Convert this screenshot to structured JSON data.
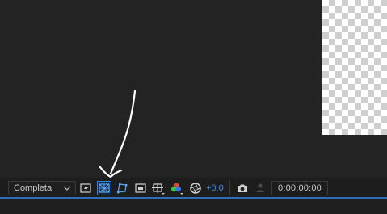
{
  "viewer": {
    "resolution": {
      "value": "Completa"
    },
    "toolbar": {
      "exposure_value": "+0.0",
      "timecode": "0:00:00:00"
    },
    "colors": {
      "accent": "#2d8ceb",
      "panel": "#232323",
      "toolbar": "#1d1d1d"
    }
  }
}
